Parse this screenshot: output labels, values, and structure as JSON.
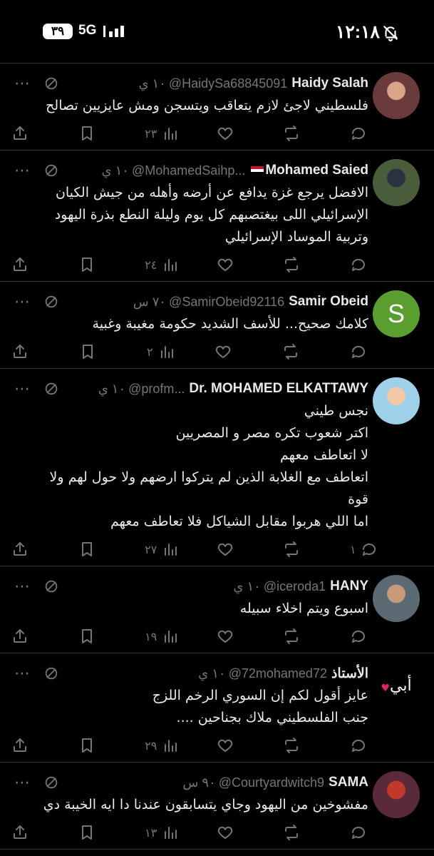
{
  "status_bar": {
    "time": "١٢:١٨",
    "network": "5G",
    "battery": "٣٩"
  },
  "replies": [
    {
      "name": "Haidy Salah",
      "flag": false,
      "handle": "@HaidySa68845091",
      "time": "١٠ ي",
      "text": "فلسطيني لاجئ لازم يتعاقب ويتسجن ومش عايزيين تصالح",
      "replies_count": "",
      "views": "٢٣",
      "avatar": {
        "kind": "photo",
        "bg": "#6b3a3a",
        "accent": "#d9a48a"
      }
    },
    {
      "name": "Mohamed Saied",
      "flag": true,
      "handle": "@MohamedSaihp...",
      "time": "١٠ ي",
      "text": "الافضل يرجع غزة يدافع عن أرضه وأهله من جيش الكيان\nالإسرائيلي اللى بيغتصبهم كل يوم وليلة النطع بذرة اليهود\nوتربية الموساد الإسرائيلي",
      "replies_count": "",
      "views": "٢٤",
      "avatar": {
        "kind": "photo",
        "bg": "#4a5d3a",
        "accent": "#2a3242"
      }
    },
    {
      "name": "Samir Obeid",
      "flag": false,
      "handle": "@SamirObeid92116",
      "time": "٧٠ س",
      "text": "كلامك صحيح... للأسف الشديد حكومة مغيبة وغبية",
      "replies_count": "",
      "views": "٢",
      "avatar": {
        "kind": "letter",
        "letter": "S",
        "bg": "#5a9e2f",
        "accent": "#ffffff"
      }
    },
    {
      "name": "Dr. MOHAMED ELKATTAWY",
      "flag": false,
      "handle": "@profm...",
      "time": "١٠ ي",
      "text": "نجس طيني\nاكتر شعوب تكره مصر و المصريين\nلا اتعاطف معهم\nاتعاطف مع الغلابة الذين لم يتركوا ارضهم ولا حول لهم ولا\nقوة\nاما اللي هربوا مقابل الشياكل فلا تعاطف معهم",
      "replies_count": "١",
      "views": "٢٧",
      "avatar": {
        "kind": "photo",
        "bg": "#9fd0ea",
        "accent": "#f2c9a8"
      }
    },
    {
      "name": "HANY",
      "flag": false,
      "handle": "@iceroda1",
      "time": "١٠ ي",
      "text": "اسبوع ويتم اخلاء سبيله",
      "replies_count": "",
      "views": "١٩",
      "avatar": {
        "kind": "photo",
        "bg": "#5b6a72",
        "accent": "#c79a7a"
      }
    },
    {
      "name": "الأستاذ",
      "flag": false,
      "handle": "@72mohamed72",
      "time": "١٠ ي",
      "text": "عايز أقول لكم إن السوري الرخم اللزج\nجنب الفلسطيني ملاك بجناحين ....",
      "replies_count": "",
      "views": "٢٩",
      "avatar": {
        "kind": "logo",
        "letter": "أبي",
        "bg": "#000000",
        "accent": "#e0245e"
      }
    },
    {
      "name": "SAMA",
      "flag": false,
      "handle": "@Courtyardwitch9",
      "time": "٩٠ س",
      "text": "مفشوخين من اليهود وجاي يتسابقون عندنا دا ايه الخيبة دي",
      "replies_count": "",
      "views": "١٣",
      "avatar": {
        "kind": "photo",
        "bg": "#5a2a3a",
        "accent": "#c0392b"
      }
    }
  ]
}
